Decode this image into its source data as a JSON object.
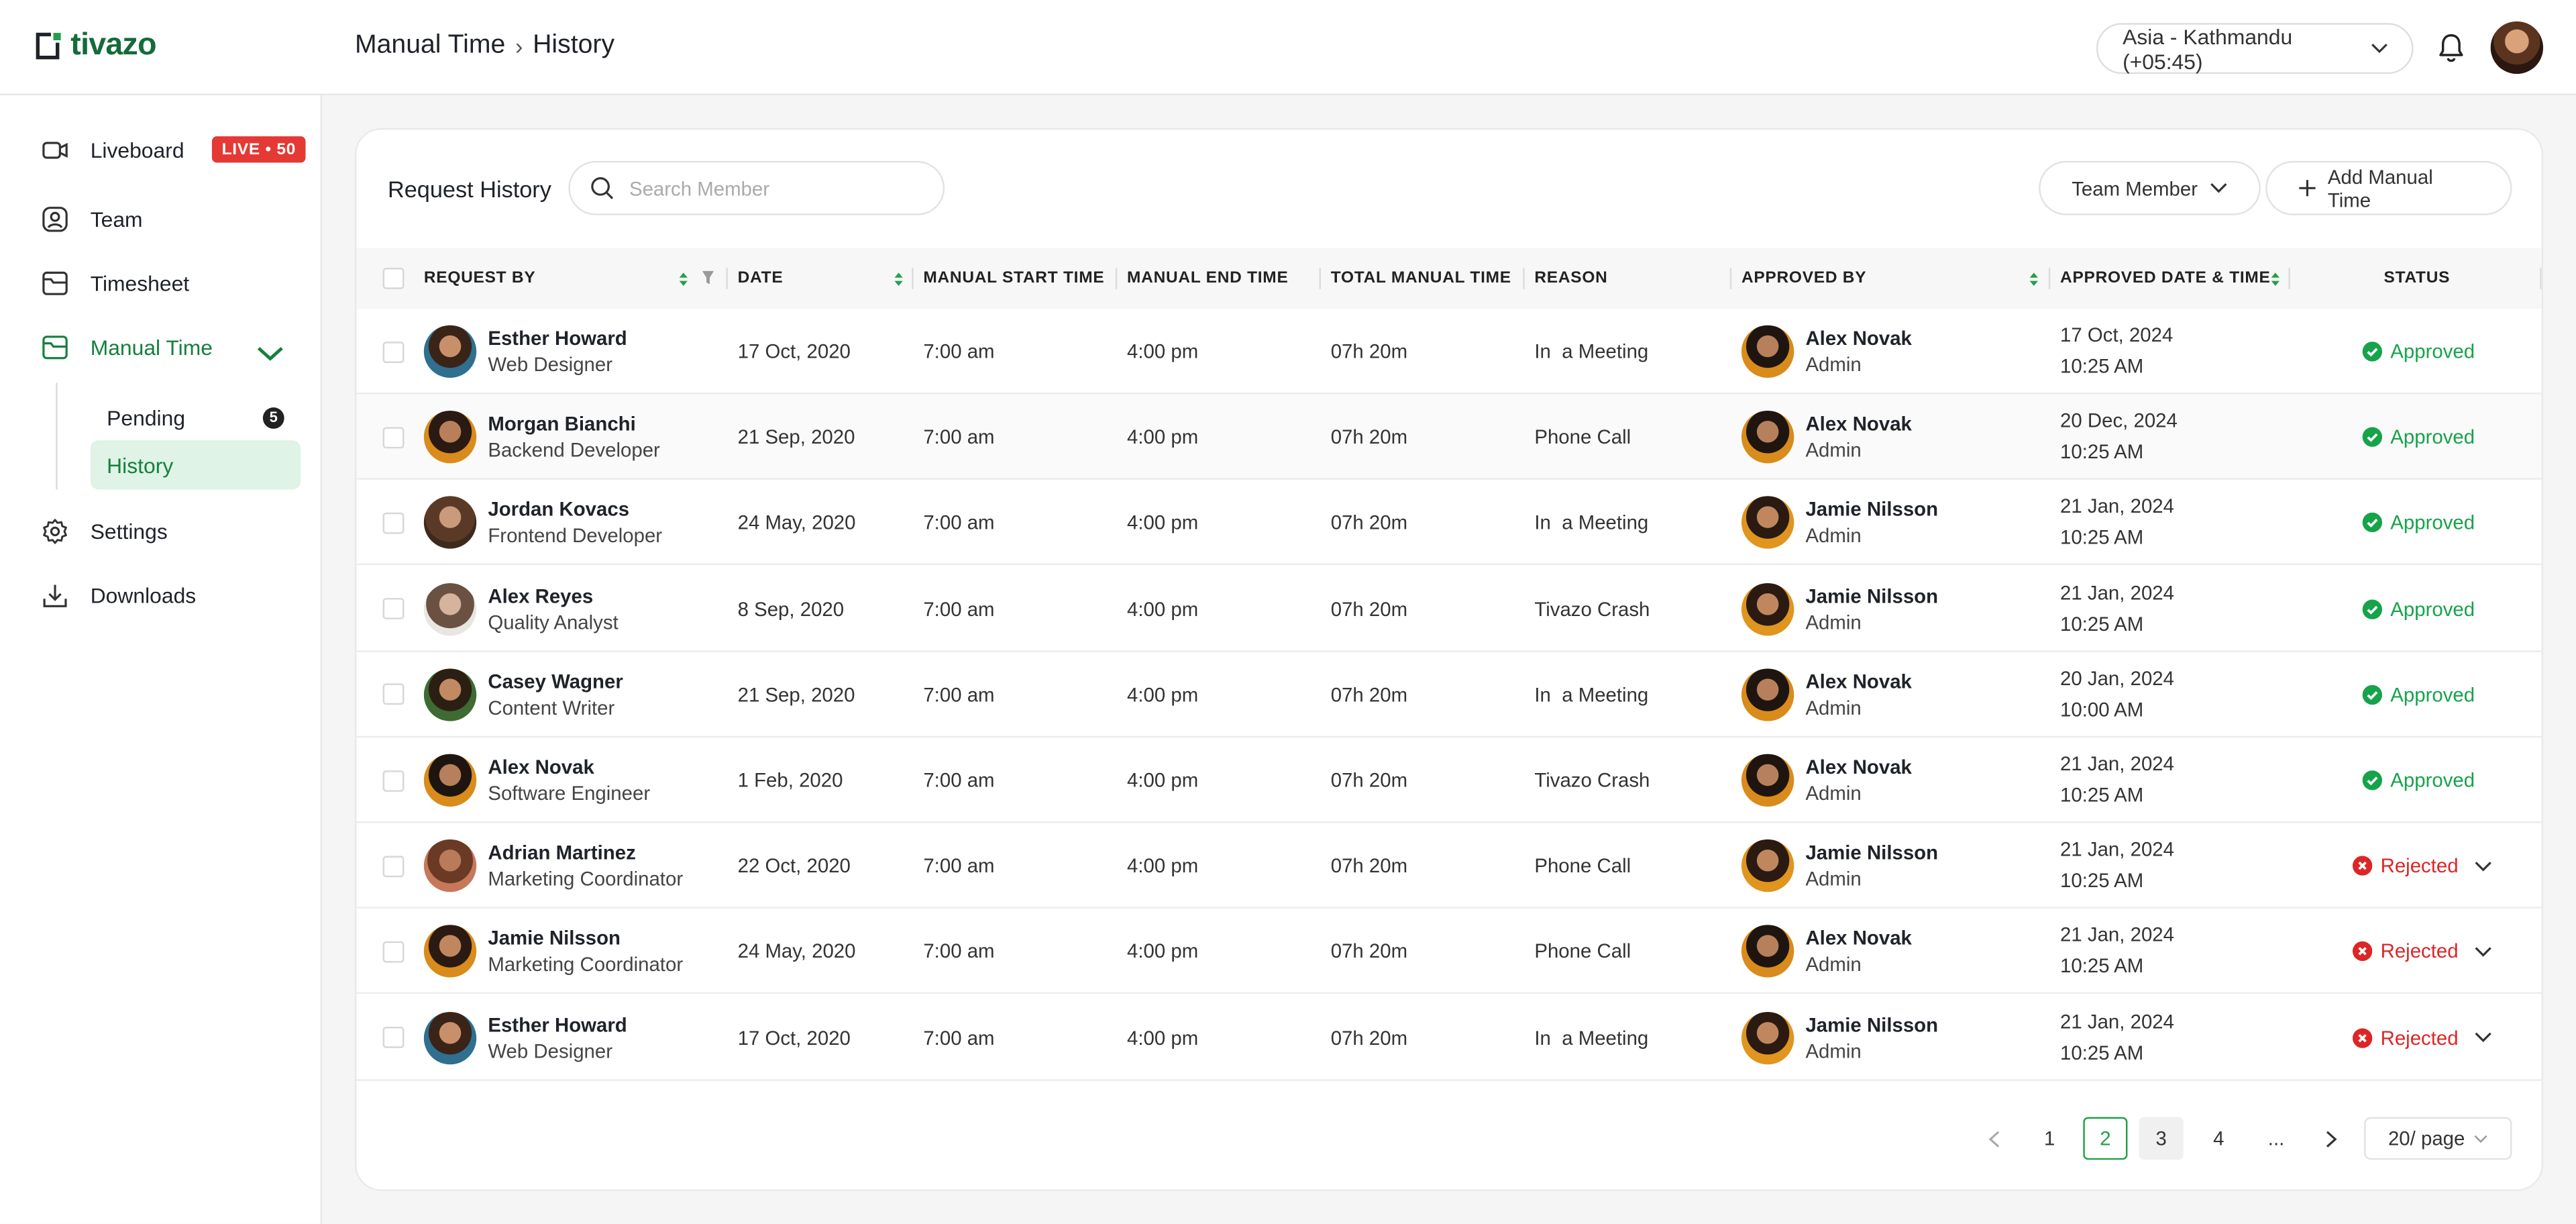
{
  "app": {
    "logo": "tivazo"
  },
  "header": {
    "breadcrumb": [
      "Manual Time",
      "History"
    ],
    "timezone": "Asia - Kathmandu (+05:45)"
  },
  "sidebar": {
    "items": [
      {
        "label": "Liveboard",
        "icon": "liveboard-icon"
      },
      {
        "label": "Team",
        "icon": "team-icon"
      },
      {
        "label": "Timesheet",
        "icon": "timesheet-icon"
      },
      {
        "label": "Manual Time",
        "icon": "manual-time-icon"
      },
      {
        "label": "Settings",
        "icon": "gear-icon"
      },
      {
        "label": "Downloads",
        "icon": "download-icon"
      }
    ],
    "live_badge": "LIVE • 50",
    "sub_items": [
      {
        "label": "Pending",
        "count": "5"
      },
      {
        "label": "History"
      }
    ]
  },
  "main": {
    "title": "Request History",
    "search_placeholder": "Search Member",
    "team_member_label": "Team Member",
    "add_label": "Add Manual Time",
    "columns": [
      "REQUEST BY",
      "DATE",
      "MANUAL START TIME",
      "MANUAL END TIME",
      "TOTAL MANUAL TIME",
      "REASON",
      "APPROVED BY",
      "APPROVED DATE & TIME",
      "STATUS"
    ],
    "rows": [
      {
        "name": "Esther Howard",
        "role": "Web Designer",
        "date": "17 Oct, 2020",
        "start": "7:00 am",
        "end": "4:00 pm",
        "total": "07h 20m",
        "reason": "In  a Meeting",
        "approver": "Alex Novak",
        "approver_role": "Admin",
        "approved_date": "17 Oct, 2024",
        "approved_time": "10:25 AM",
        "status": "Approved"
      },
      {
        "name": "Morgan Bianchi",
        "role": "Backend Developer",
        "date": "21 Sep, 2020",
        "start": "7:00 am",
        "end": "4:00 pm",
        "total": "07h 20m",
        "reason": "Phone Call",
        "approver": "Alex Novak",
        "approver_role": "Admin",
        "approved_date": "20 Dec, 2024",
        "approved_time": "10:25 AM",
        "status": "Approved"
      },
      {
        "name": "Jordan Kovacs",
        "role": "Frontend Developer",
        "date": "24 May, 2020",
        "start": "7:00 am",
        "end": "4:00 pm",
        "total": "07h 20m",
        "reason": "In  a Meeting",
        "approver": "Jamie Nilsson",
        "approver_role": "Admin",
        "approved_date": "21 Jan, 2024",
        "approved_time": "10:25 AM",
        "status": "Approved"
      },
      {
        "name": "Alex Reyes",
        "role": "Quality Analyst",
        "date": "8 Sep, 2020",
        "start": "7:00 am",
        "end": "4:00 pm",
        "total": "07h 20m",
        "reason": "Tivazo Crash",
        "approver": "Jamie Nilsson",
        "approver_role": "Admin",
        "approved_date": "21 Jan, 2024",
        "approved_time": "10:25 AM",
        "status": "Approved"
      },
      {
        "name": "Casey Wagner",
        "role": "Content Writer",
        "date": "21 Sep, 2020",
        "start": "7:00 am",
        "end": "4:00 pm",
        "total": "07h 20m",
        "reason": "In  a Meeting",
        "approver": "Alex Novak",
        "approver_role": "Admin",
        "approved_date": "20 Jan, 2024",
        "approved_time": "10:00 AM",
        "status": "Approved"
      },
      {
        "name": "Alex Novak",
        "role": "Software Engineer",
        "date": "1 Feb, 2020",
        "start": "7:00 am",
        "end": "4:00 pm",
        "total": "07h 20m",
        "reason": "Tivazo Crash",
        "approver": "Alex Novak",
        "approver_role": "Admin",
        "approved_date": "21 Jan, 2024",
        "approved_time": "10:25 AM",
        "status": "Approved"
      },
      {
        "name": "Adrian Martinez",
        "role": "Marketing Coordinator",
        "date": "22 Oct, 2020",
        "start": "7:00 am",
        "end": "4:00 pm",
        "total": "07h 20m",
        "reason": "Phone Call",
        "approver": "Jamie Nilsson",
        "approver_role": "Admin",
        "approved_date": "21 Jan, 2024",
        "approved_time": "10:25 AM",
        "status": "Rejected"
      },
      {
        "name": "Jamie Nilsson",
        "role": "Marketing Coordinator",
        "date": "24 May, 2020",
        "start": "7:00 am",
        "end": "4:00 pm",
        "total": "07h 20m",
        "reason": "Phone Call",
        "approver": "Alex Novak",
        "approver_role": "Admin",
        "approved_date": "21 Jan, 2024",
        "approved_time": "10:25 AM",
        "status": "Rejected"
      },
      {
        "name": "Esther Howard",
        "role": "Web Designer",
        "date": "17 Oct, 2020",
        "start": "7:00 am",
        "end": "4:00 pm",
        "total": "07h 20m",
        "reason": "In  a Meeting",
        "approver": "Jamie Nilsson",
        "approver_role": "Admin",
        "approved_date": "21 Jan, 2024",
        "approved_time": "10:25 AM",
        "status": "Rejected"
      }
    ]
  },
  "pagination": {
    "pages": [
      "1",
      "2",
      "3",
      "4",
      "..."
    ],
    "current": "2",
    "per_page": "20/ page"
  },
  "colors": {
    "brand": "#146b3a",
    "accent": "#22a04a",
    "approved": "#16a34a",
    "rejected": "#dc2626",
    "live": "#e53935"
  }
}
